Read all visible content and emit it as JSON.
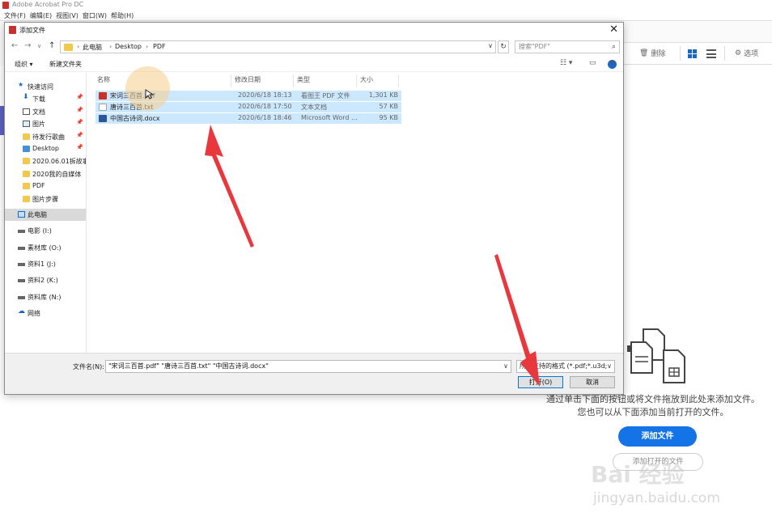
{
  "app": {
    "title": "Adobe Acrobat Pro DC",
    "menu": [
      "文件(F)",
      "编辑(E)",
      "视图(V)",
      "窗口(W)",
      "帮助(H)"
    ],
    "toolbar": {
      "delete_label": "删除",
      "options_label": "选项"
    },
    "drop_message_line1": "通过单击下面的按钮或将文件拖放到此处来添加文件。",
    "drop_message_line2": "您也可以从下面添加当前打开的文件。",
    "add_files_label": "添加文件",
    "add_open_label": "添加打开的文件",
    "watermark": "Bai 经验",
    "watermark_url": "jingyan.baidu.com"
  },
  "dialog": {
    "title": "添加文件",
    "breadcrumb": [
      "此电脑",
      "Desktop",
      "PDF"
    ],
    "search_placeholder": "搜索\"PDF\"",
    "organize_label": "组织 ▾",
    "new_folder_label": "新建文件夹",
    "nav": [
      {
        "label": "快速访问",
        "icon": "star-icon"
      },
      {
        "label": "下载",
        "icon": "download-icon",
        "pinned": true
      },
      {
        "label": "文档",
        "icon": "document-icon",
        "pinned": true
      },
      {
        "label": "图片",
        "icon": "picture-icon",
        "pinned": true
      },
      {
        "label": "待发行歌曲",
        "icon": "folder-icon",
        "pinned": true
      },
      {
        "label": "Desktop",
        "icon": "folder-icon",
        "pinned": true
      },
      {
        "label": "2020.06.01拆故事\\",
        "icon": "folder-icon"
      },
      {
        "label": "2020我的自媒体",
        "icon": "folder-icon"
      },
      {
        "label": "PDF",
        "icon": "folder-icon"
      },
      {
        "label": "图片步骤",
        "icon": "folder-icon"
      },
      {
        "label": "此电脑",
        "icon": "computer-icon",
        "selected": true
      },
      {
        "label": "电影 (I:)",
        "icon": "drive-icon"
      },
      {
        "label": "素材库 (O:)",
        "icon": "drive-icon"
      },
      {
        "label": "资料1 (J:)",
        "icon": "drive-icon"
      },
      {
        "label": "资料2 (K:)",
        "icon": "drive-icon"
      },
      {
        "label": "资料库 (N:)",
        "icon": "drive-icon"
      },
      {
        "label": "网络",
        "icon": "network-icon"
      }
    ],
    "columns": [
      "名称",
      "修改日期",
      "类型",
      "大小"
    ],
    "files": [
      {
        "name": "宋词三百首.pdf",
        "date": "2020/6/18 18:13",
        "type": "看图王 PDF 文件",
        "size": "1,301 KB",
        "icon": "pdf-icon",
        "color": "#c9302c"
      },
      {
        "name": "唐诗三百首.txt",
        "date": "2020/6/18 17:50",
        "type": "文本文档",
        "size": "57 KB",
        "icon": "txt-icon",
        "color": "#9aa5b1"
      },
      {
        "name": "中国古诗词.docx",
        "date": "2020/6/18 18:46",
        "type": "Microsoft Word ...",
        "size": "95 KB",
        "icon": "docx-icon",
        "color": "#2b579a"
      }
    ],
    "filename_label": "文件名(N):",
    "filename_value": "\"宋词三百首.pdf\" \"唐诗三百首.txt\" \"中国古诗词.docx\"",
    "filetype_value": "所有支持的格式 (*.pdf;*.u3d;*.",
    "open_label": "打开(O)",
    "cancel_label": "取消"
  },
  "colors": {
    "accent": "#1473e6",
    "selection": "#cce8ff",
    "arrow": "#e8373d"
  }
}
